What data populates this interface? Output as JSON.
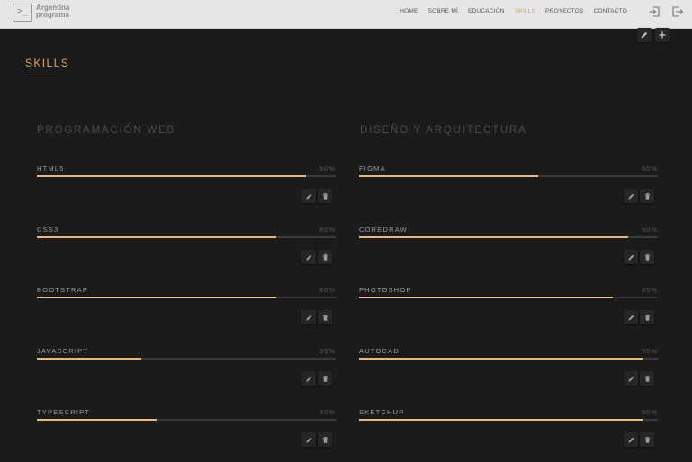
{
  "brand": {
    "prompt": ">_",
    "line1": "Argentina",
    "line2": "programa"
  },
  "nav": {
    "items": [
      {
        "label": "HOME",
        "active": false
      },
      {
        "label": "SOBRE MÍ",
        "active": false
      },
      {
        "label": "EDUCACIÓN",
        "active": false
      },
      {
        "label": "SKILLS",
        "active": true
      },
      {
        "label": "PROYECTOS",
        "active": false
      },
      {
        "label": "CONTACTO",
        "active": false
      }
    ],
    "icons": [
      "login-icon",
      "logout-icon"
    ]
  },
  "section": {
    "title": "SKILLS",
    "tool_icons": [
      "pencil-icon",
      "plus-icon"
    ]
  },
  "columns": [
    {
      "title": "PROGRAMACIÓN WEB",
      "skills": [
        {
          "name": "HTML5",
          "percent_label": "90%",
          "percent": 90
        },
        {
          "name": "CSS3",
          "percent_label": "80%",
          "percent": 80
        },
        {
          "name": "BOOTSTRAP",
          "percent_label": "80%",
          "percent": 80
        },
        {
          "name": "JAVASCRIPT",
          "percent_label": "35%",
          "percent": 35
        },
        {
          "name": "TYPESCRIPT",
          "percent_label": "40%",
          "percent": 40
        }
      ]
    },
    {
      "title": "DISEÑO Y ARQUITECTURA",
      "skills": [
        {
          "name": "FIGMA",
          "percent_label": "60%",
          "percent": 60
        },
        {
          "name": "COREDRAW",
          "percent_label": "90%",
          "percent": 90
        },
        {
          "name": "PHOTOSHOP",
          "percent_label": "85%",
          "percent": 85
        },
        {
          "name": "AUTOCAD",
          "percent_label": "95%",
          "percent": 95
        },
        {
          "name": "SKETCHUP",
          "percent_label": "95%",
          "percent": 95
        }
      ]
    }
  ],
  "colors": {
    "accent": "#e1a65a",
    "bar_fill": "#e6b883",
    "bar_track": "#3a3a3a",
    "background": "#1b1b1b",
    "nav_bg": "#e6e6e6"
  }
}
